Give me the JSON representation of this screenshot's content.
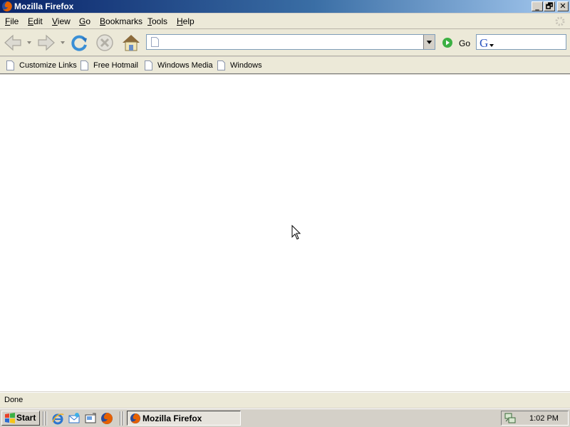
{
  "window": {
    "title": "Mozilla Firefox",
    "controls": {
      "minimize": "_",
      "maximize": "🗗",
      "close": "✕"
    }
  },
  "menu": [
    {
      "first": "F",
      "rest": "ile"
    },
    {
      "first": "E",
      "rest": "dit"
    },
    {
      "first": "V",
      "rest": "iew"
    },
    {
      "first": "G",
      "rest": "o"
    },
    {
      "first": "B",
      "rest": "ookmarks"
    },
    {
      "first": "T",
      "rest": "ools"
    },
    {
      "first": "H",
      "rest": "elp"
    }
  ],
  "navigation": {
    "icons": [
      "back-icon",
      "forward-icon",
      "reload-icon",
      "stop-icon",
      "home-icon"
    ],
    "url": {
      "value": "",
      "placeholder": ""
    },
    "go_label": "Go",
    "search": {
      "value": "",
      "placeholder": ""
    }
  },
  "bookmarks": [
    {
      "label": "Customize Links"
    },
    {
      "label": "Free Hotmail"
    },
    {
      "label": "Windows Media"
    },
    {
      "label": "Windows"
    }
  ],
  "status": {
    "text": "Done"
  },
  "taskbar": {
    "start_label": "Start",
    "quick_launch": [
      "internet-explorer-icon",
      "outlook-express-icon",
      "show-desktop-icon",
      "firefox-icon"
    ],
    "task_label": "Mozilla Firefox",
    "clock": "1:02 PM"
  },
  "colors": {
    "titlebar_start": "#0a246a",
    "titlebar_end": "#a6caf0",
    "chrome": "#ece9d8",
    "content_bg": "#ffffff"
  }
}
